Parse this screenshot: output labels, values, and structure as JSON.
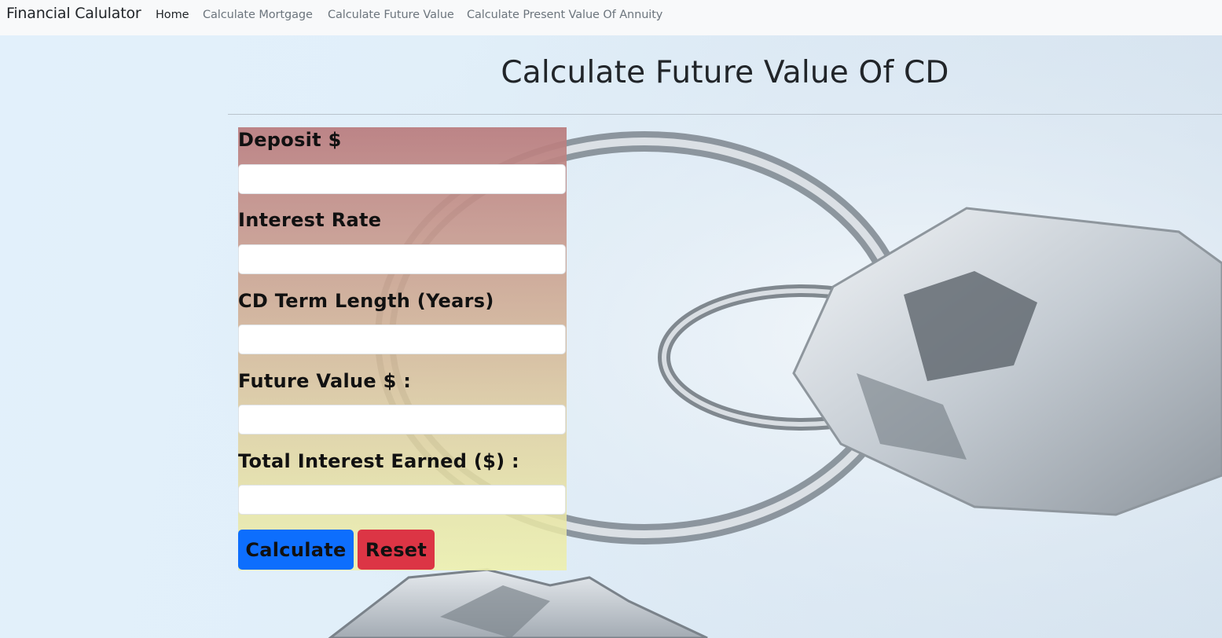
{
  "navbar": {
    "brand": "Financial Calulator",
    "links": [
      {
        "label": "Home",
        "active": true
      },
      {
        "label": "Calculate Mortgage",
        "active": false
      },
      {
        "label": "Calculate Future Value",
        "active": false
      },
      {
        "label": "Calculate Present Value Of Annuity",
        "active": false
      }
    ]
  },
  "page": {
    "title": "Calculate Future Value Of CD"
  },
  "form": {
    "fields": [
      {
        "label": "Deposit $",
        "value": ""
      },
      {
        "label": "Interest Rate",
        "value": ""
      },
      {
        "label": "CD Term Length (Years)",
        "value": ""
      },
      {
        "label": "Future Value $ :",
        "value": ""
      },
      {
        "label": "Total Interest Earned ($) :",
        "value": ""
      }
    ],
    "buttons": {
      "calculate": "Calculate",
      "reset": "Reset"
    }
  },
  "colors": {
    "navbar_bg": "#f8f9fa",
    "primary": "#0d6efd",
    "danger": "#dc3545",
    "panel_top": "#b97b7d",
    "panel_bottom": "#eef0aa"
  },
  "icons": {
    "background": "house-keys-photo"
  }
}
